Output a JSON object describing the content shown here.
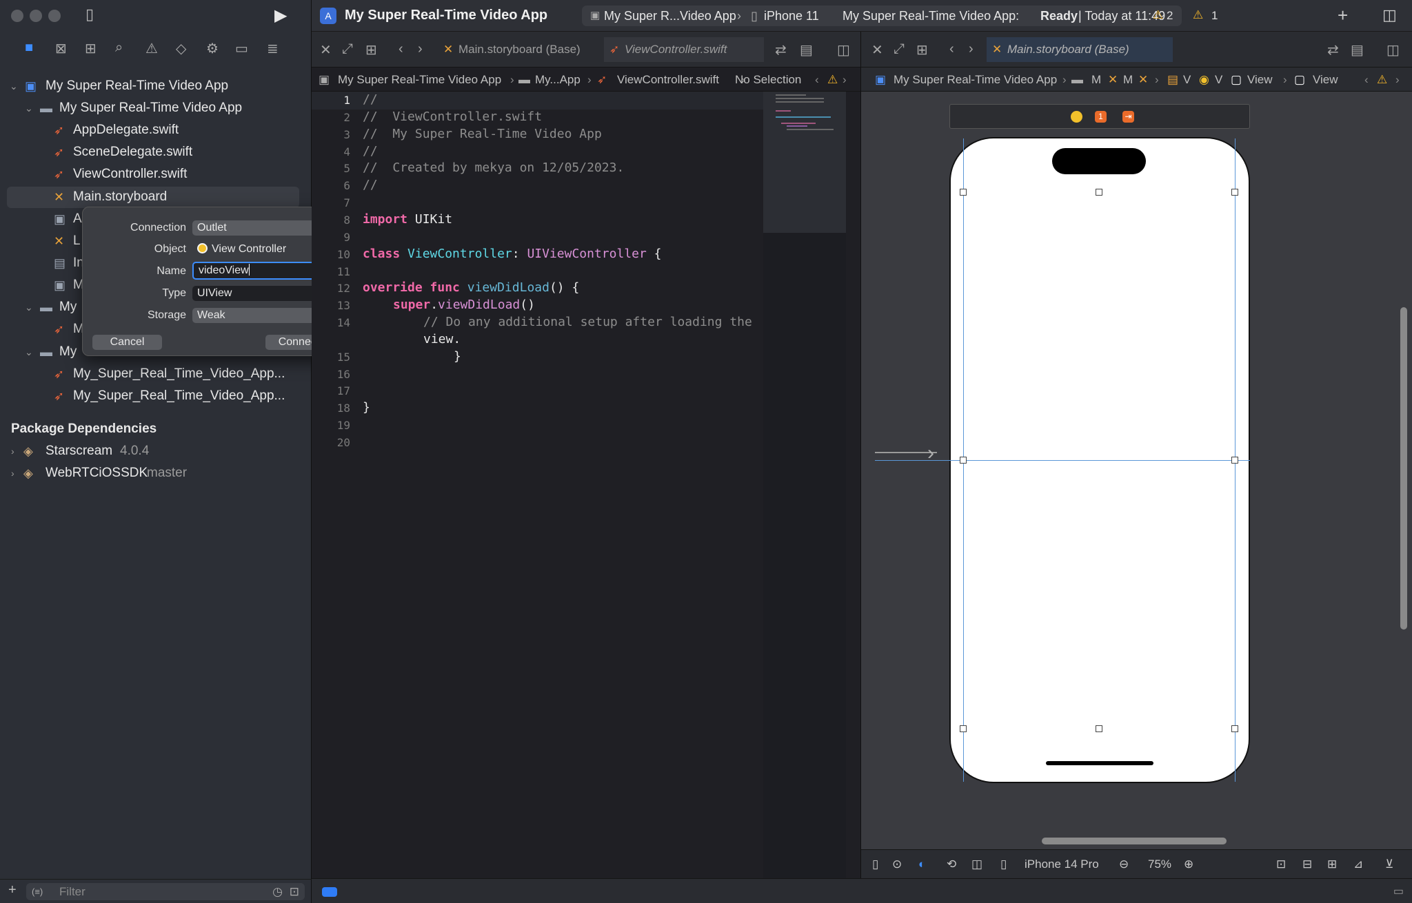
{
  "toolbar": {
    "project_title": "My Super Real-Time Video App",
    "scheme_name": "My Super R...Video App",
    "destination": "iPhone 11",
    "status_app": "My Super Real-Time Video App:",
    "status_state": "Ready",
    "status_time": "| Today at 11:49",
    "warnings_count": "2",
    "issues_count": "1"
  },
  "sidebar": {
    "root": "My Super Real-Time Video App",
    "group": "My Super Real-Time Video App",
    "files": [
      "AppDelegate.swift",
      "SceneDelegate.swift",
      "ViewController.swift",
      "Main.storyboard"
    ],
    "obscured_rows": [
      "A",
      "L",
      "In",
      "M"
    ],
    "group2": "My",
    "group2_child": "M",
    "group3": "My",
    "test_files": [
      "My_Super_Real_Time_Video_App...",
      "My_Super_Real_Time_Video_App..."
    ],
    "package_dependencies_title": "Package Dependencies",
    "packages": [
      {
        "name": "Starscream",
        "version": "4.0.4"
      },
      {
        "name": "WebRTCiOSSDK",
        "version": "master"
      }
    ],
    "filter_placeholder": "Filter"
  },
  "popover": {
    "connection_label": "Connection",
    "connection_value": "Outlet",
    "object_label": "Object",
    "object_value": "View Controller",
    "name_label": "Name",
    "name_value": "videoView",
    "type_label": "Type",
    "type_value": "UIView",
    "storage_label": "Storage",
    "storage_value": "Weak",
    "cancel": "Cancel",
    "connect": "Connect"
  },
  "left_editor": {
    "tabs": [
      "Main.storyboard (Base)",
      "ViewController.swift"
    ],
    "breadcrumb": [
      "My Super Real-Time Video App",
      "My...App",
      "ViewController.swift",
      "No Selection"
    ],
    "code_lines": [
      {
        "n": "1",
        "text": "//"
      },
      {
        "n": "2",
        "text": "//  ViewController.swift"
      },
      {
        "n": "3",
        "text": "//  My Super Real-Time Video App"
      },
      {
        "n": "4",
        "text": "//"
      },
      {
        "n": "5",
        "text": "//  Created by mekya on 12/05/2023."
      },
      {
        "n": "6",
        "text": "//"
      },
      {
        "n": "7",
        "text": ""
      },
      {
        "n": "8",
        "text": "import UIKit"
      },
      {
        "n": "9",
        "text": ""
      },
      {
        "n": "10",
        "text": "class ViewController: UIViewController {"
      },
      {
        "n": "11",
        "text": ""
      },
      {
        "n": "12",
        "text": "override func viewDidLoad() {"
      },
      {
        "n": "13",
        "text": "super.viewDidLoad()"
      },
      {
        "n": "14",
        "text": "// Do any additional setup after loading the"
      },
      {
        "n": "",
        "text": "view."
      },
      {
        "n": "15",
        "text": "}"
      },
      {
        "n": "16",
        "text": ""
      },
      {
        "n": "17",
        "text": ""
      },
      {
        "n": "18",
        "text": "}"
      },
      {
        "n": "19",
        "text": ""
      },
      {
        "n": "20",
        "text": ""
      }
    ]
  },
  "right_editor": {
    "tab": "Main.storyboard (Base)",
    "breadcrumb": [
      "My Super Real-Time Video App",
      "M",
      "M",
      "V",
      "V",
      "View",
      "View"
    ],
    "device": "iPhone 14 Pro",
    "zoom": "75%"
  },
  "colors": {
    "accent": "#2f7cf6",
    "selection_guide": "#5b97d8",
    "keyword": "#f069a8",
    "type": "#5fd8e6",
    "comment": "#8d8d8d",
    "warning": "#f2b42a"
  }
}
